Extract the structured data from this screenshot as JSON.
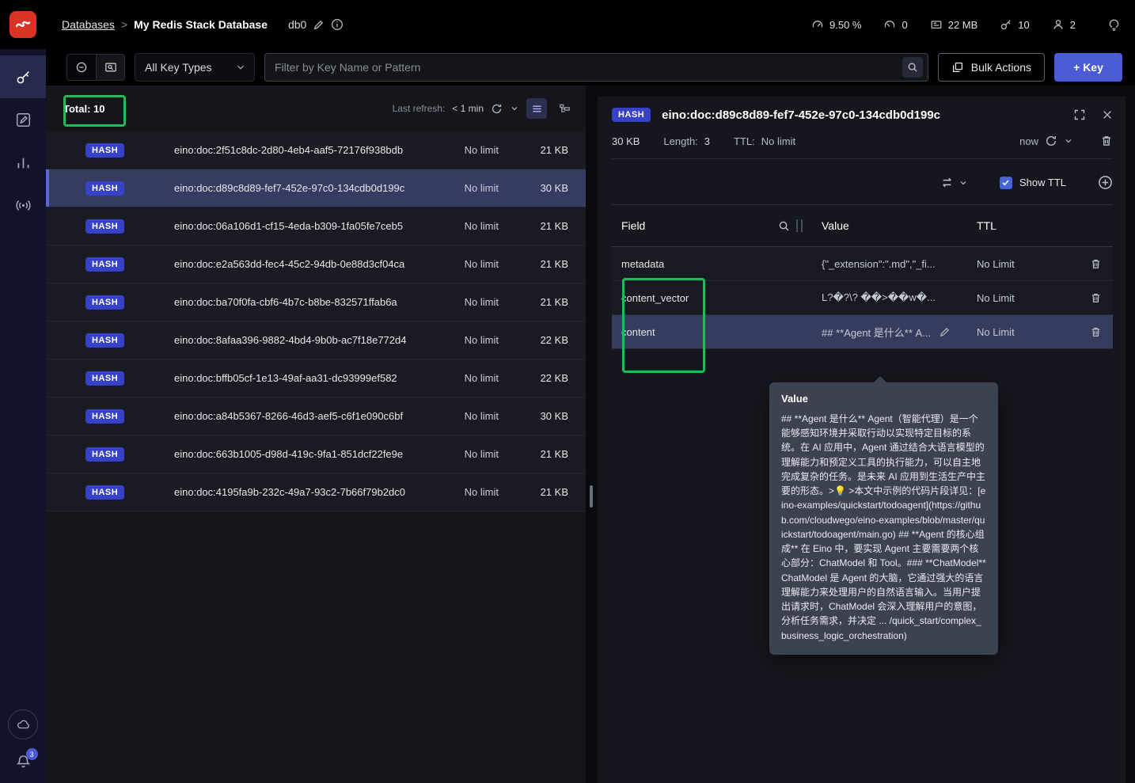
{
  "colors": {
    "annotation_green": "#21ba59",
    "hash_badge": "#3742c7",
    "primary_button": "#4b5bd6",
    "selected_row": "#363c61"
  },
  "header": {
    "breadcrumb": {
      "databases": "Databases",
      "separator": ">",
      "db_name": "My Redis Stack Database",
      "db_alias": "db0"
    },
    "metrics": {
      "cpu": "9.50 %",
      "commands": "0",
      "memory": "22 MB",
      "keys": "10",
      "clients": "2"
    }
  },
  "filter_bar": {
    "key_type_filter": "All Key Types",
    "search_placeholder": "Filter by Key Name or Pattern",
    "bulk_actions": "Bulk Actions",
    "add_key": "+ Key"
  },
  "sidebar": {
    "notification_count": "3"
  },
  "key_list": {
    "total": "Total: 10",
    "last_refresh_label": "Last refresh:",
    "last_refresh_value": "< 1 min",
    "rows": [
      {
        "type": "HASH",
        "name": "eino:doc:2f51c8dc-2d80-4eb4-aaf5-72176f938bdb",
        "ttl": "No limit",
        "size": "21 KB",
        "selected": false
      },
      {
        "type": "HASH",
        "name": "eino:doc:d89c8d89-fef7-452e-97c0-134cdb0d199c",
        "ttl": "No limit",
        "size": "30 KB",
        "selected": true
      },
      {
        "type": "HASH",
        "name": "eino:doc:06a106d1-cf15-4eda-b309-1fa05fe7ceb5",
        "ttl": "No limit",
        "size": "21 KB",
        "selected": false
      },
      {
        "type": "HASH",
        "name": "eino:doc:e2a563dd-fec4-45c2-94db-0e88d3cf04ca",
        "ttl": "No limit",
        "size": "21 KB",
        "selected": false
      },
      {
        "type": "HASH",
        "name": "eino:doc:ba70f0fa-cbf6-4b7c-b8be-832571ffab6a",
        "ttl": "No limit",
        "size": "21 KB",
        "selected": false
      },
      {
        "type": "HASH",
        "name": "eino:doc:8afaa396-9882-4bd4-9b0b-ac7f18e772d4",
        "ttl": "No limit",
        "size": "22 KB",
        "selected": false
      },
      {
        "type": "HASH",
        "name": "eino:doc:bffb05cf-1e13-49af-aa31-dc93999ef582",
        "ttl": "No limit",
        "size": "22 KB",
        "selected": false
      },
      {
        "type": "HASH",
        "name": "eino:doc:a84b5367-8266-46d3-aef5-c6f1e090c6bf",
        "ttl": "No limit",
        "size": "30 KB",
        "selected": false
      },
      {
        "type": "HASH",
        "name": "eino:doc:663b1005-d98d-419c-9fa1-851dcf22fe9e",
        "ttl": "No limit",
        "size": "21 KB",
        "selected": false
      },
      {
        "type": "HASH",
        "name": "eino:doc:4195fa9b-232c-49a7-93c2-7b66f79b2dc0",
        "ttl": "No limit",
        "size": "21 KB",
        "selected": false
      }
    ]
  },
  "details": {
    "type": "HASH",
    "key_name": "eino:doc:d89c8d89-fef7-452e-97c0-134cdb0d199c",
    "size": "30 KB",
    "length_label": "Length:",
    "length_value": "3",
    "ttl_label": "TTL:",
    "ttl_value": "No limit",
    "refresh_time": "now",
    "show_ttl": "Show TTL",
    "table": {
      "headers": {
        "field": "Field",
        "value": "Value",
        "ttl": "TTL"
      },
      "rows": [
        {
          "field": "metadata",
          "value": "{\"_extension\":\".md\",\"_fi...",
          "ttl": "No Limit",
          "selected": false,
          "editable": false
        },
        {
          "field": "content_vector",
          "value": "L?�?\\? ��>��w�...",
          "ttl": "No Limit",
          "selected": false,
          "editable": false
        },
        {
          "field": "content",
          "value": "## **Agent 是什么** A...",
          "ttl": "No Limit",
          "selected": true,
          "editable": true
        }
      ]
    },
    "tooltip": {
      "title": "Value",
      "body": "## **Agent 是什么** Agent（智能代理）是一个能够感知环境并采取行动以实现特定目标的系统。在 AI 应用中，Agent 通过结合大语言模型的理解能力和预定义工具的执行能力，可以自主地完成复杂的任务。是未来 AI 应用到生活生产中主要的形态。>💡 >本文中示例的代码片段详见：[eino-examples/quickstart/todoagent](https://github.com/cloudwego/eino-examples/blob/master/quickstart/todoagent/main.go) ## **Agent 的核心组成** 在 Eino 中，要实现 Agent 主要需要两个核心部分：ChatModel 和 Tool。### **ChatModel** ChatModel 是 Agent 的大脑，它通过强大的语言理解能力来处理用户的自然语言输入。当用户提出请求时，ChatModel 会深入理解用户的意图，分析任务需求，并决定 ... /quick_start/complex_business_logic_orchestration)"
    }
  }
}
